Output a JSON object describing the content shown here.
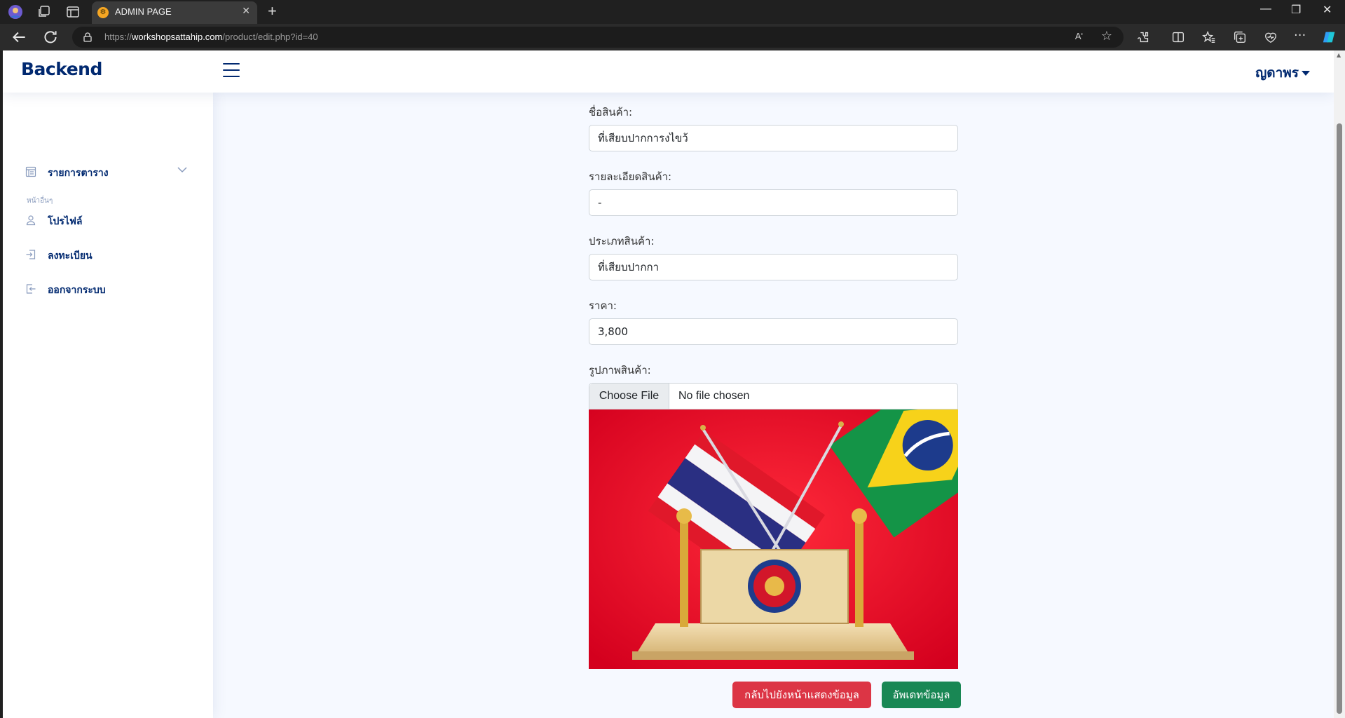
{
  "browser": {
    "tab_title": "ADMIN PAGE",
    "url_prefix": "https://",
    "url_domain": "workshopsattahip.com",
    "url_path": "/product/edit.php?id=40",
    "read_aloud_label": "Aʹ"
  },
  "header": {
    "logo": "Backend",
    "user_name": "ญดาพร"
  },
  "sidebar": {
    "menu_tables": "รายการตาราง",
    "section_heading": "หน้าอื่นๆ",
    "items": [
      {
        "label": "โปรไฟล์",
        "icon": "person-icon"
      },
      {
        "label": "ลงทะเบียน",
        "icon": "login-icon"
      },
      {
        "label": "ออกจากระบบ",
        "icon": "logout-icon"
      }
    ]
  },
  "form": {
    "name_label": "ชื่อสินค้า:",
    "name_value": "ที่เสียบปากการงไขว้",
    "detail_label": "รายละเอียดสินค้า:",
    "detail_value": "-",
    "type_label": "ประเภทสินค้า:",
    "type_value": "ที่เสียบปากกา",
    "price_label": "ราคา:",
    "price_value": "3,800",
    "image_label": "รูปภาพสินค้า:",
    "file_button": "Choose File",
    "file_status": "No file chosen",
    "back_button": "กลับไปยังหน้าแสดงข้อมูล",
    "update_button": "อัพเดทข้อมูล"
  },
  "colors": {
    "brand": "#012970",
    "page_bg": "#f6f9ff",
    "danger": "#dc3545",
    "success": "#198754"
  }
}
